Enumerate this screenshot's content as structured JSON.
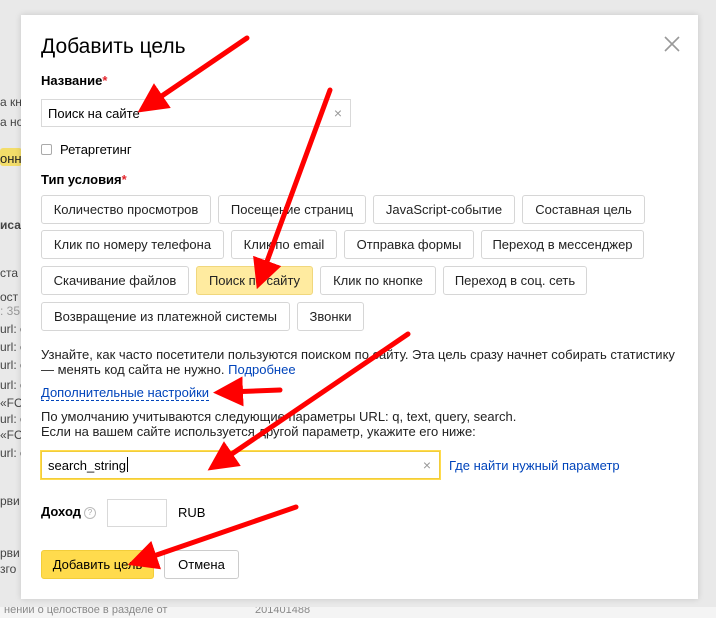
{
  "background": {
    "fragments": [
      "а кн",
      "а но",
      "онно",
      "иса",
      "ста",
      "ост",
      ": 35",
      "url: c",
      "url: c",
      "url: c",
      "url: c",
      "«FO",
      "url: c",
      "«FO",
      "url: c",
      "рви",
      "рви",
      "зго"
    ],
    "bottom_text": "нении о целоствое в разделе от",
    "bottom_number": "201401488"
  },
  "modal": {
    "title": "Добавить цель",
    "name_label": "Название",
    "required_mark": "*",
    "name_value": "Поиск на сайте",
    "clear_symbol": "×",
    "retargeting_label": "Ретаргетинг",
    "condition_label": "Тип условия",
    "condition_types": [
      "Количество просмотров",
      "Посещение страниц",
      "JavaScript-событие",
      "Составная цель",
      "Клик по номеру телефона",
      "Клик по email",
      "Отправка формы",
      "Переход в мессенджер",
      "Скачивание файлов",
      "Поиск по сайту",
      "Клик по кнопке",
      "Переход в соц. сеть",
      "Возвращение из платежной системы",
      "Звонки"
    ],
    "selected_condition": "Поиск по сайту",
    "description": "Узнайте, как часто посетители пользуются поиском по сайту. Эта цель сразу начнет собирать статистику — менять код сайта не нужно.",
    "description_link": "Подробнее",
    "advanced_settings_link": "Дополнительные настройки",
    "params_info_line1": "По умолчанию учитываются следующие параметры URL: q, text, query, search.",
    "params_info_line2": "Если на вашем сайте используется другой параметр, укажите его ниже:",
    "param_value": "search_string",
    "where_to_find_link": "Где найти нужный параметр",
    "income_label": "Доход",
    "help_symbol": "?",
    "income_value": "",
    "currency": "RUB",
    "submit_label": "Добавить цель",
    "cancel_label": "Отмена"
  },
  "colors": {
    "accent_yellow": "#ffdb4d",
    "selected_chip": "#ffeba0",
    "link": "#0044bb",
    "required": "#e4252c",
    "annotation_arrow": "#ff0000"
  },
  "icons": {
    "close": "close-icon",
    "clear": "clear-icon",
    "help": "help-icon"
  }
}
